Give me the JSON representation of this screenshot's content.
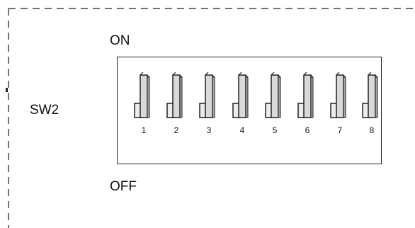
{
  "labels": {
    "on": "ON",
    "off": "OFF",
    "switch_name": "SW2"
  },
  "switch_numbers": [
    "1",
    "2",
    "3",
    "4",
    "5",
    "6",
    "7",
    "8"
  ],
  "colors": {
    "stroke": "#222222",
    "lever_face": "#d9d9d9",
    "lever_side": "#a9a9a9",
    "base_face": "#ececec"
  }
}
